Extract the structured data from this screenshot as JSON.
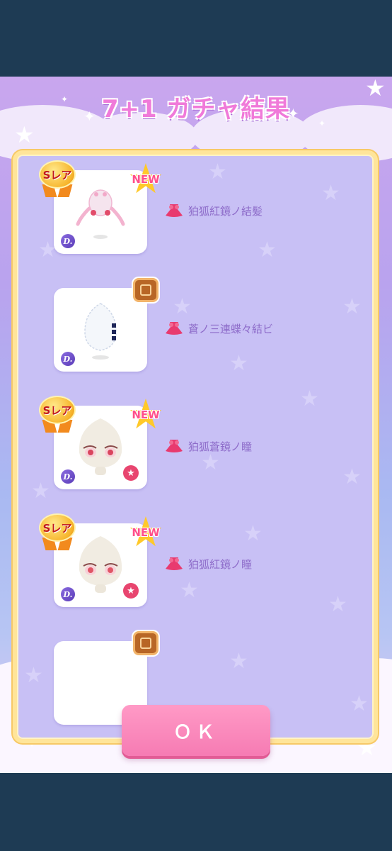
{
  "popup": {
    "title": "7+1 ガチャ結果",
    "ok_button": "ＯＫ"
  },
  "badges": {
    "rarity_label": "Sレア",
    "new_label": "NEW",
    "designer_mark": "D."
  },
  "results": [
    {
      "name": "狛狐紅鏡ノ結髪",
      "rarity": "Sレア",
      "is_new": true,
      "indicator": "new",
      "has_favorite": false,
      "art": "hair-accessory"
    },
    {
      "name": "蒼ノ三連蝶々結ビ",
      "rarity": "",
      "is_new": false,
      "indicator": "bag",
      "has_favorite": false,
      "art": "ribbon"
    },
    {
      "name": "狛狐蒼鏡ノ瞳",
      "rarity": "Sレア",
      "is_new": true,
      "indicator": "new",
      "has_favorite": true,
      "art": "eyes"
    },
    {
      "name": "狛狐紅鏡ノ瞳",
      "rarity": "Sレア",
      "is_new": true,
      "indicator": "new",
      "has_favorite": true,
      "art": "eyes"
    },
    {
      "name": "",
      "rarity": "",
      "is_new": false,
      "indicator": "bag",
      "has_favorite": false,
      "art": "partial"
    }
  ],
  "colors": {
    "title": "#f07ad9",
    "item_name": "#8d6bc9",
    "ok_button": "#f67bb3",
    "panel_border": "#ffe59a",
    "background_dark": "#1e3b54"
  }
}
